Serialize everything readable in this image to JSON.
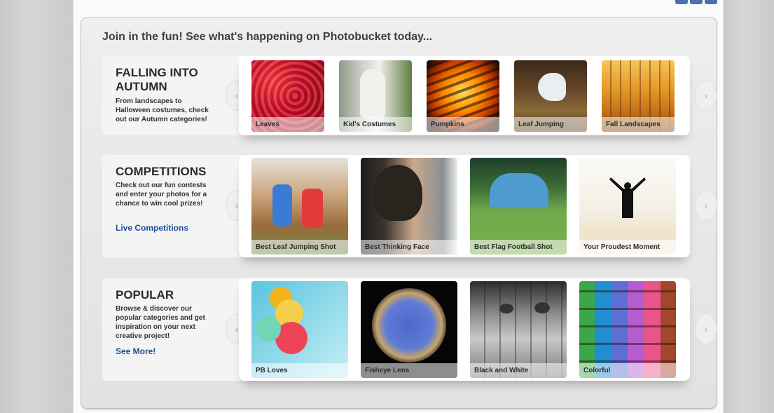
{
  "headline": "Join in the fun! See what's happening on Photobucket today...",
  "rows": [
    {
      "title": "FALLING INTO AUTUMN",
      "description": "From landscapes to Halloween costumes, check out our Autumn categories!",
      "link": "",
      "items": [
        {
          "label": "Leaves",
          "icon": "leaves-photo"
        },
        {
          "label": "Kid's Costumes",
          "icon": "costume-photo"
        },
        {
          "label": "Pumpkins",
          "icon": "pumpkin-photo"
        },
        {
          "label": "Leaf Jumping",
          "icon": "leaf-jumping-photo"
        },
        {
          "label": "Fall Landscapes",
          "icon": "fall-landscape-photo"
        }
      ]
    },
    {
      "title": "COMPETITIONS",
      "description": "Check out our fun contests and enter your photos for a chance to win cool prizes!",
      "link": "Live Competitions",
      "items": [
        {
          "label": "Best Leaf Jumping Shot",
          "icon": "leaf-jump-photo"
        },
        {
          "label": "Best Thinking Face",
          "icon": "baby-photo"
        },
        {
          "label": "Best Flag Football Shot",
          "icon": "football-photo"
        },
        {
          "label": "Your Proudest Moment",
          "icon": "silhouette-photo"
        }
      ]
    },
    {
      "title": "POPULAR",
      "description": "Browse & discover our popular categories and get inspiration on your next creative project!",
      "link": "See More!",
      "items": [
        {
          "label": "PB Loves",
          "icon": "balloons-photo"
        },
        {
          "label": "Fisheye Lens",
          "icon": "fisheye-photo"
        },
        {
          "label": "Black and White",
          "icon": "snails-photo"
        },
        {
          "label": "Colorful",
          "icon": "chalk-photo"
        }
      ]
    }
  ],
  "arrows": {
    "prev": "‹",
    "next": "›"
  },
  "colors": {
    "link": "#1f4f99",
    "panel": "#e8e8e8",
    "page": "#fbfbfb"
  }
}
